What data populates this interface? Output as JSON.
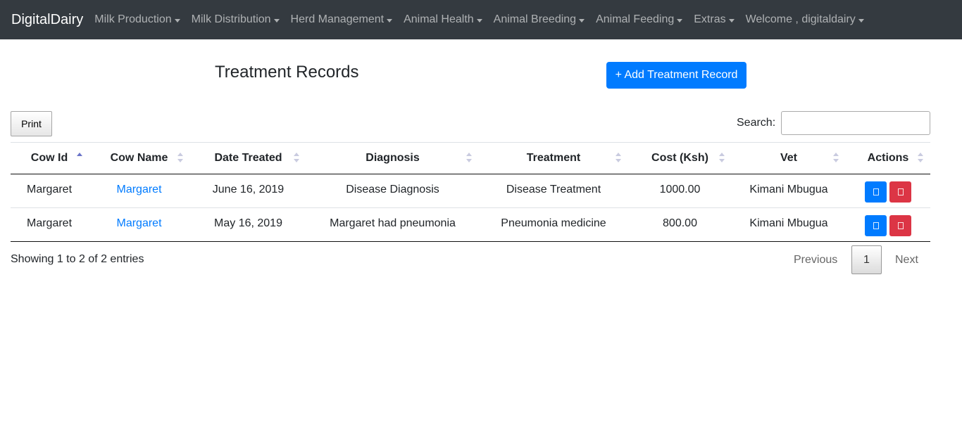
{
  "navbar": {
    "brand": "DigitalDairy",
    "items": [
      {
        "label": "Milk Production"
      },
      {
        "label": "Milk Distribution"
      },
      {
        "label": "Herd Management"
      },
      {
        "label": "Animal Health"
      },
      {
        "label": "Animal Breeding"
      },
      {
        "label": "Animal Feeding"
      },
      {
        "label": "Extras"
      },
      {
        "label": "Welcome , digitaldairy"
      }
    ]
  },
  "page": {
    "title": "Treatment Records",
    "add_button": "+ Add Treatment Record"
  },
  "toolbar": {
    "print_label": "Print",
    "search_label": "Search:",
    "search_value": ""
  },
  "table": {
    "columns": [
      "Cow Id",
      "Cow Name",
      "Date Treated",
      "Diagnosis",
      "Treatment",
      "Cost (Ksh)",
      "Vet",
      "Actions"
    ],
    "sorted_column": "Cow Id",
    "sort_direction": "ascending",
    "rows": [
      {
        "cow_id": "Margaret",
        "cow_name": "Margaret",
        "date_treated": "June 16, 2019",
        "diagnosis": "Disease Diagnosis",
        "treatment": "Disease Treatment",
        "cost": "1000.00",
        "vet": "Kimani Mbugua"
      },
      {
        "cow_id": "Margaret",
        "cow_name": "Margaret",
        "date_treated": "May 16, 2019",
        "diagnosis": "Margaret had pneumonia",
        "treatment": "Pneumonia medicine",
        "cost": "800.00",
        "vet": "Kimani Mbugua"
      }
    ],
    "action_icons": [
      "edit-icon",
      "delete-icon"
    ]
  },
  "footer": {
    "info": "Showing 1 to 2 of 2 entries",
    "previous": "Previous",
    "page": "1",
    "next": "Next"
  },
  "colors": {
    "navbar": "#343a40",
    "primary": "#007bff",
    "danger": "#dc3545"
  }
}
